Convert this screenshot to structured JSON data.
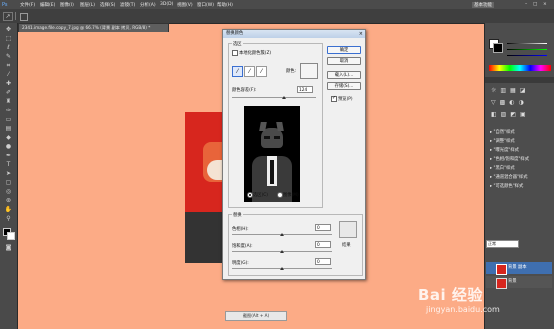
{
  "menu": {
    "items": [
      "文件(F)",
      "编辑(E)",
      "图像(I)",
      "图层(L)",
      "选择(S)",
      "滤镜(T)",
      "分析(A)",
      "3D(D)",
      "视图(V)",
      "窗口(W)",
      "帮助(H)"
    ],
    "right_label": "基本功能"
  },
  "document": {
    "tab_title": "2341.image.file.copy_7.jpg @ 66.7% (背景 副本 拷贝, RGB/8) *"
  },
  "dialog": {
    "title": "替换颜色",
    "selection_group": "选区",
    "localized_clusters_label": "本地化颜色簇(Z)",
    "color_label": "颜色:",
    "fuzziness_label": "颜色容差(F):",
    "fuzziness_value": "124",
    "fuzziness_fraction": 0.62,
    "radio_selection": "选区(C)",
    "radio_image": "图像(M)",
    "replacement_group": "替换",
    "hue_label": "色相(H):",
    "hue_value": "0",
    "saturation_label": "饱和度(A):",
    "saturation_value": "0",
    "lightness_label": "明度(G):",
    "lightness_value": "0",
    "result_label": "结果",
    "buttons": {
      "ok": "确定",
      "cancel": "取消",
      "load": "载入(L)...",
      "save": "存储(S)...",
      "preview": "预览(P)"
    },
    "preview_checked": true
  },
  "layers": {
    "mode": "正常",
    "rows": [
      "背景 副本",
      "背景"
    ]
  },
  "panels": {
    "style_rows": [
      "\"自然\"样式",
      "\"调整\"样式",
      "\"曝光度\"样式",
      "\"色相/饱和度\"样式",
      "\"黑白\"样式",
      "\"通道混合器\"样式",
      "\"可选颜色\"样式"
    ]
  },
  "status": {
    "chip": "截图(Alt + A)"
  },
  "watermark": {
    "brand": "Bai 经验",
    "url": "jingyan.baidu.com"
  },
  "colors": {
    "canvas_bg": "#fcab86",
    "chrome_dark": "#4b4b4b",
    "dialog_bg": "#f0f0f0"
  }
}
